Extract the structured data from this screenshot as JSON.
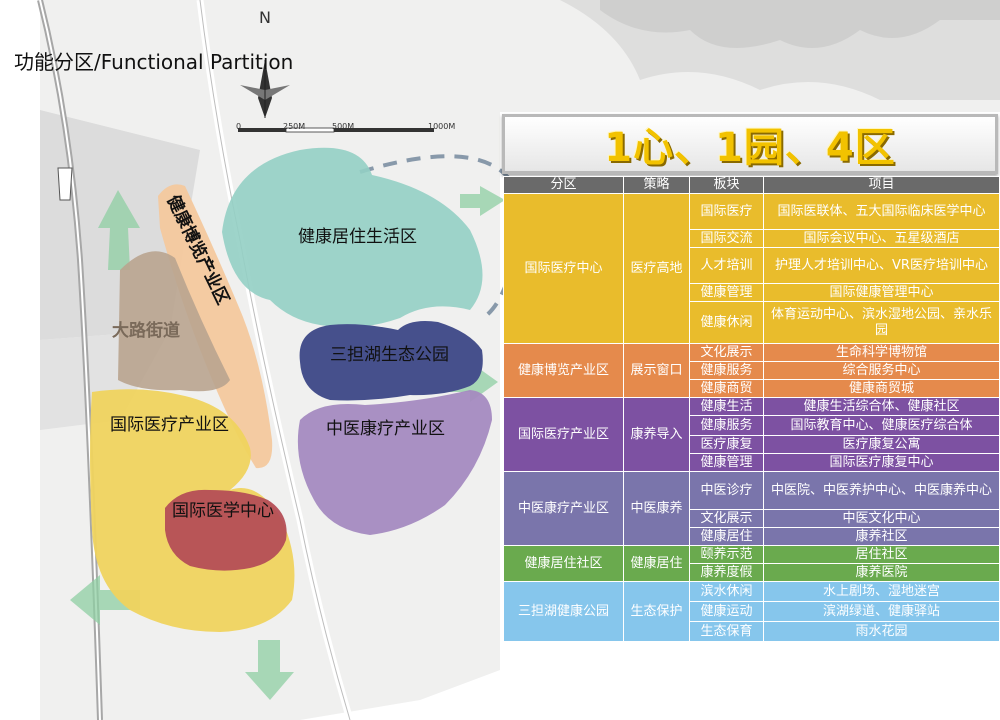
{
  "title": "功能分区/Functional Partition",
  "north": "N",
  "scale": [
    "0",
    "250M",
    "500M",
    "1000M"
  ],
  "map_labels": {
    "living": "健康居住生活区",
    "expo": "健康博览产业区",
    "street": "大路街道",
    "lake": "三担湖生态公园",
    "medical_industry": "国际医疗产业区",
    "tcm": "中医康疗产业区",
    "med_center": "国际医学中心"
  },
  "headline": "1心、1园、4区",
  "table": {
    "headers": [
      "分区",
      "策略",
      "板块",
      "项目"
    ],
    "groups": [
      {
        "zone": "国际医疗中心",
        "strategy": "医疗高地",
        "color": "#e9bc2c",
        "rows": [
          {
            "block": "国际医疗",
            "project": "国际医联体、五大国际临床医学中心",
            "h": 36
          },
          {
            "block": "国际交流",
            "project": "国际会议中心、五星级酒店",
            "h": 18
          },
          {
            "block": "人才培训",
            "project": "护理人才培训中心、VR医疗培训中心",
            "h": 36
          },
          {
            "block": "健康管理",
            "project": "国际健康管理中心",
            "h": 18
          },
          {
            "block": "健康休闲",
            "project": "体育运动中心、滨水湿地公园、亲水乐园",
            "h": 42
          }
        ]
      },
      {
        "zone": "健康博览产业区",
        "strategy": "展示窗口",
        "color": "#e58a4c",
        "rows": [
          {
            "block": "文化展示",
            "project": "生命科学博物馆",
            "h": 18
          },
          {
            "block": "健康服务",
            "project": "综合服务中心",
            "h": 18
          },
          {
            "block": "健康商贸",
            "project": "健康商贸城",
            "h": 18
          }
        ]
      },
      {
        "zone": "国际医疗产业区",
        "strategy": "康养导入",
        "color": "#7d51a2",
        "rows": [
          {
            "block": "健康生活",
            "project": "健康生活综合体、健康社区",
            "h": 18
          },
          {
            "block": "健康服务",
            "project": "国际教育中心、健康医疗综合体",
            "h": 20
          },
          {
            "block": "医疗康复",
            "project": "医疗康复公寓",
            "h": 18
          },
          {
            "block": "健康管理",
            "project": "国际医疗康复中心",
            "h": 18
          }
        ]
      },
      {
        "zone": "中医康疗产业区",
        "strategy": "中医康养",
        "color": "#7a75ab",
        "rows": [
          {
            "block": "中医诊疗",
            "project": "中医院、中医养护中心、中医康养中心",
            "h": 38
          },
          {
            "block": "文化展示",
            "project": "中医文化中心",
            "h": 18
          },
          {
            "block": "健康居住",
            "project": "康养社区",
            "h": 18
          }
        ]
      },
      {
        "zone": "健康居住社区",
        "strategy": "健康居住",
        "color": "#6aaa4e",
        "rows": [
          {
            "block": "颐养示范",
            "project": "居住社区",
            "h": 18
          },
          {
            "block": "康养度假",
            "project": "康养医院",
            "h": 18
          }
        ]
      },
      {
        "zone": "三担湖健康公园",
        "strategy": "生态保护",
        "color": "#86c6ec",
        "rows": [
          {
            "block": "滨水休闲",
            "project": "水上剧场、湿地迷宫",
            "h": 20
          },
          {
            "block": "健康运动",
            "project": "滨湖绿道、健康驿站",
            "h": 20
          },
          {
            "block": "生态保育",
            "project": "雨水花园",
            "h": 20
          }
        ]
      }
    ]
  },
  "colors": {
    "living": "#93cfc4",
    "expo": "#f4c89b",
    "street": "#b9a48f",
    "lake": "#46508c",
    "medical_industry": "#efd35e",
    "tcm": "#a48ac0",
    "med_center": "#b44e56",
    "arrow": "#8fcfa3"
  }
}
